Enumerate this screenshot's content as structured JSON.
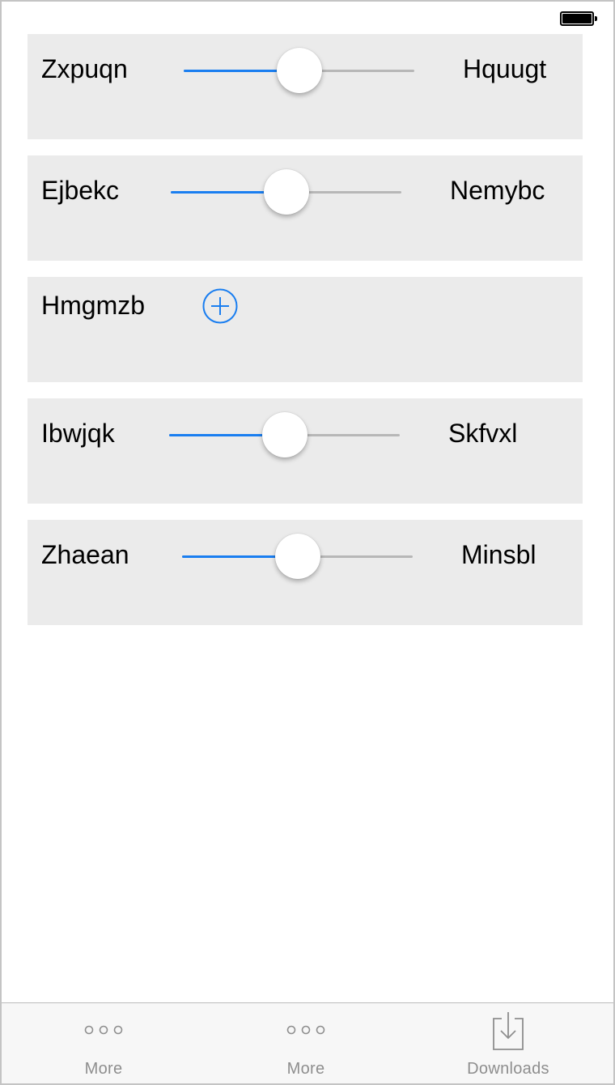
{
  "status_bar": {
    "battery_icon": "battery-full-icon"
  },
  "rows": [
    {
      "left_label": "Zxpuqn",
      "right_label": "Hquugt",
      "type": "slider",
      "value": 0.5
    },
    {
      "left_label": "Ejbekc",
      "right_label": "Nemybc",
      "type": "slider",
      "value": 0.5
    },
    {
      "left_label": "Hmgmzb",
      "type": "add",
      "icon": "plus-circle-icon"
    },
    {
      "left_label": "Ibwjqk",
      "right_label": "Skfvxl",
      "type": "slider",
      "value": 0.5
    },
    {
      "left_label": "Zhaean",
      "right_label": "Minsbl",
      "type": "slider",
      "value": 0.5
    }
  ],
  "tabbar": {
    "items": [
      {
        "label": "More",
        "icon": "more-icon"
      },
      {
        "label": "More",
        "icon": "more-icon"
      },
      {
        "label": "Downloads",
        "icon": "downloads-icon"
      }
    ]
  },
  "colors": {
    "accent": "#1a7ef0",
    "card_bg": "#ebebeb",
    "track": "#b7b7b7",
    "tab_label": "#8e8e8e"
  }
}
